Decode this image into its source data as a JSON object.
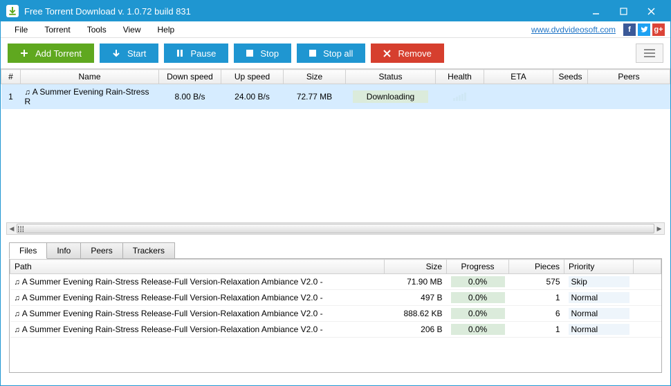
{
  "window": {
    "title": "Free Torrent Download v. 1.0.72 build 831"
  },
  "menu": {
    "file": "File",
    "torrent": "Torrent",
    "tools": "Tools",
    "view": "View",
    "help": "Help",
    "link": "www.dvdvideosoft.com"
  },
  "toolbar": {
    "add": "Add Torrent",
    "start": "Start",
    "pause": "Pause",
    "stop": "Stop",
    "stopall": "Stop all",
    "remove": "Remove"
  },
  "columns": {
    "num": "#",
    "name": "Name",
    "down": "Down speed",
    "up": "Up speed",
    "size": "Size",
    "status": "Status",
    "health": "Health",
    "eta": "ETA",
    "seeds": "Seeds",
    "peers": "Peers"
  },
  "torrents": [
    {
      "num": "1",
      "name": "A Summer Evening Rain-Stress R",
      "down": "8.00 B/s",
      "up": "24.00 B/s",
      "size": "72.77 MB",
      "status": "Downloading",
      "eta": "",
      "seeds": "",
      "peers": ""
    }
  ],
  "tabs": {
    "files": "Files",
    "info": "Info",
    "peers": "Peers",
    "trackers": "Trackers"
  },
  "files_columns": {
    "path": "Path",
    "size": "Size",
    "progress": "Progress",
    "pieces": "Pieces",
    "priority": "Priority"
  },
  "files": [
    {
      "path": "A Summer Evening Rain-Stress Release-Full Version-Relaxation Ambiance V2.0 -",
      "size": "71.90 MB",
      "progress": "0.0%",
      "pieces": "575",
      "priority": "Skip"
    },
    {
      "path": "A Summer Evening Rain-Stress Release-Full Version-Relaxation Ambiance V2.0 -",
      "size": "497 B",
      "progress": "0.0%",
      "pieces": "1",
      "priority": "Normal"
    },
    {
      "path": "A Summer Evening Rain-Stress Release-Full Version-Relaxation Ambiance V2.0 -",
      "size": "888.62 KB",
      "progress": "0.0%",
      "pieces": "6",
      "priority": "Normal"
    },
    {
      "path": "A Summer Evening Rain-Stress Release-Full Version-Relaxation Ambiance V2.0 -",
      "size": "206 B",
      "progress": "0.0%",
      "pieces": "1",
      "priority": "Normal"
    }
  ]
}
